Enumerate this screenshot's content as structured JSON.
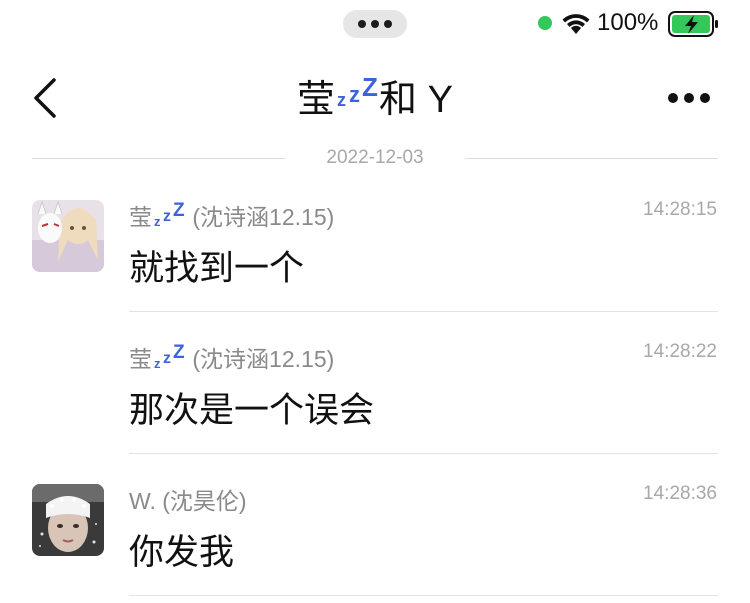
{
  "status_bar": {
    "battery_text": "100%",
    "colors": {
      "green_dot": "#34c759",
      "battery_fill": "#34c759"
    }
  },
  "nav": {
    "title_prefix": "莹",
    "title_zzz": [
      "z",
      "z",
      "Z"
    ],
    "title_suffix": "和 Y",
    "back_icon": "chevron-left-icon",
    "more_icon": "more-dots-icon"
  },
  "date_divider": "2022-12-03",
  "messages": [
    {
      "sender_prefix": "莹",
      "sender_zzz": [
        "z",
        "z",
        "Z"
      ],
      "sender_suffix": "(沈诗涵12.15)",
      "time": "14:28:15",
      "text": "就找到一个",
      "has_avatar": true
    },
    {
      "sender_prefix": "莹",
      "sender_zzz": [
        "z",
        "z",
        "Z"
      ],
      "sender_suffix": "(沈诗涵12.15)",
      "time": "14:28:22",
      "text": "那次是一个误会",
      "has_avatar": false
    },
    {
      "sender_prefix": "W.",
      "sender_suffix": "(沈昊伦)",
      "time": "14:28:36",
      "text": "你发我",
      "has_avatar": true
    }
  ],
  "accent_color": "#3d63d8"
}
